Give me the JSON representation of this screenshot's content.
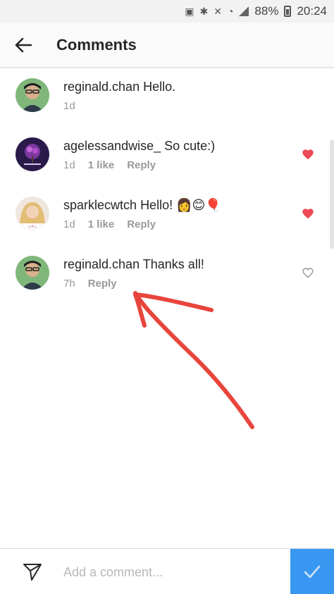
{
  "status_bar": {
    "battery": "88%",
    "time": "20:24"
  },
  "header": {
    "title": "Comments",
    "back_icon": "arrow-left-icon"
  },
  "comments": [
    {
      "username": "reginald.chan",
      "text": "Hello.",
      "time": "1d",
      "likes": "",
      "reply": "",
      "liked": false,
      "show_heart": false
    },
    {
      "username": "agelessandwise_",
      "text": "So cute:)",
      "time": "1d",
      "likes": "1 like",
      "reply": "Reply",
      "liked": true,
      "show_heart": true
    },
    {
      "username": "sparklecwtch",
      "text": "Hello! 👩😊🎈",
      "time": "1d",
      "likes": "1 like",
      "reply": "Reply",
      "liked": true,
      "show_heart": true
    },
    {
      "username": "reginald.chan",
      "text": "Thanks all!",
      "time": "7h",
      "likes": "",
      "reply": "Reply",
      "liked": false,
      "show_heart": true
    }
  ],
  "composer": {
    "placeholder": "Add a comment..."
  },
  "colors": {
    "heart_red": "#ed4956",
    "post_blue": "#3897f0",
    "annotation_red": "#e8453c"
  }
}
